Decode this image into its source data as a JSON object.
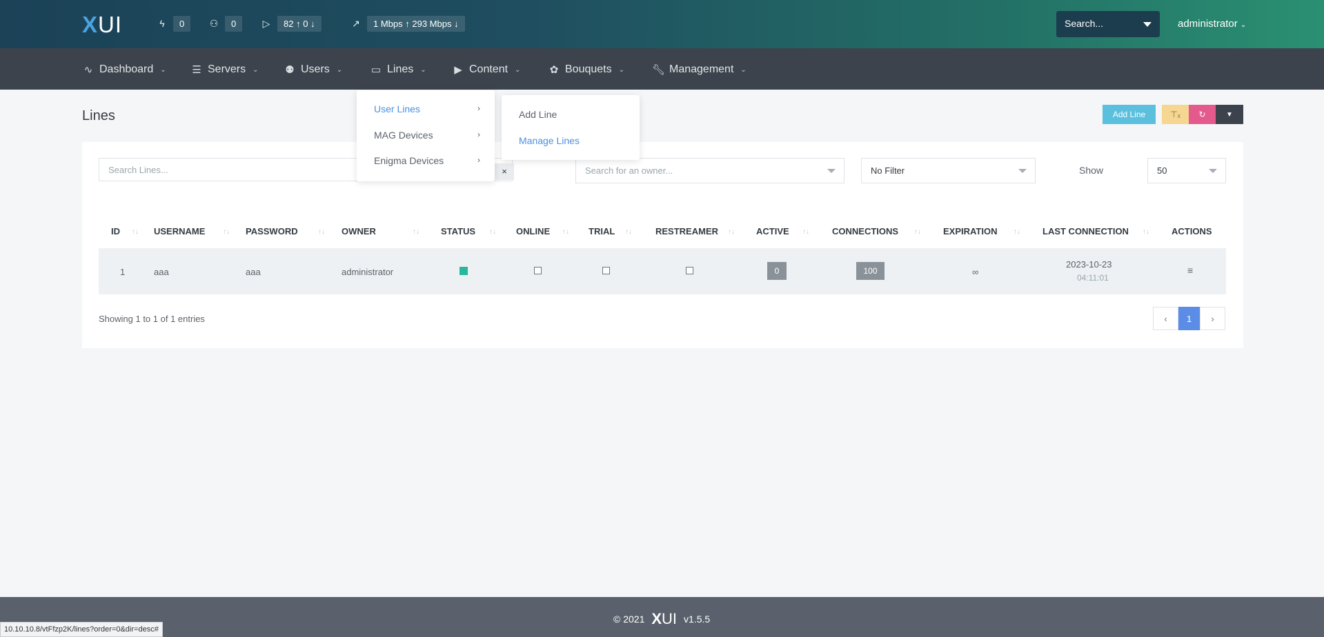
{
  "brand": {
    "logo_text": "UI",
    "logo_x": "X",
    "version": "v1.5.5",
    "copyright": "© 2021"
  },
  "topbar": {
    "stats": [
      {
        "icon": "bolt-icon",
        "value": "0"
      },
      {
        "icon": "users-icon",
        "value": "0"
      },
      {
        "icon": "play-icon",
        "value_up": "82",
        "value_down": "0"
      },
      {
        "icon": "trend-icon",
        "value_up": "1 Mbps",
        "value_down": "293 Mbps"
      }
    ],
    "search_label": "Search...",
    "user_name": "administrator"
  },
  "nav": {
    "items": [
      "Dashboard",
      "Servers",
      "Users",
      "Lines",
      "Content",
      "Bouquets",
      "Management"
    ]
  },
  "lines_menu": {
    "items": [
      "User Lines",
      "MAG Devices",
      "Enigma Devices"
    ],
    "submenu": [
      "Add Line",
      "Manage Lines"
    ]
  },
  "page": {
    "title": "Lines",
    "add_label": "Add Line"
  },
  "filters": {
    "search_placeholder": "Search Lines...",
    "owner_placeholder": "Search for an owner...",
    "status_filter": "No Filter",
    "show_label": "Show",
    "show_value": "50"
  },
  "table": {
    "columns": [
      "ID",
      "USERNAME",
      "PASSWORD",
      "OWNER",
      "STATUS",
      "ONLINE",
      "TRIAL",
      "RESTREAMER",
      "ACTIVE",
      "CONNECTIONS",
      "EXPIRATION",
      "LAST CONNECTION",
      "ACTIONS"
    ],
    "rows": [
      {
        "id": "1",
        "username": "aaa",
        "password": "aaa",
        "owner": "administrator",
        "active": "0",
        "connections": "100",
        "expiration": "∞",
        "last_date": "2023-10-23",
        "last_time": "04:11:01"
      }
    ],
    "info": "Showing 1 to 1 of 1 entries",
    "page": "1"
  },
  "status_url": "10.10.10.8/vtFfzp2K/lines?order=0&dir=desc#",
  "colors": {
    "accent": "#4aa3df",
    "info_btn": "#5bc0de",
    "warn_btn": "#f5d791",
    "pink_btn": "#e55a8c",
    "status_green": "#26b89e"
  }
}
